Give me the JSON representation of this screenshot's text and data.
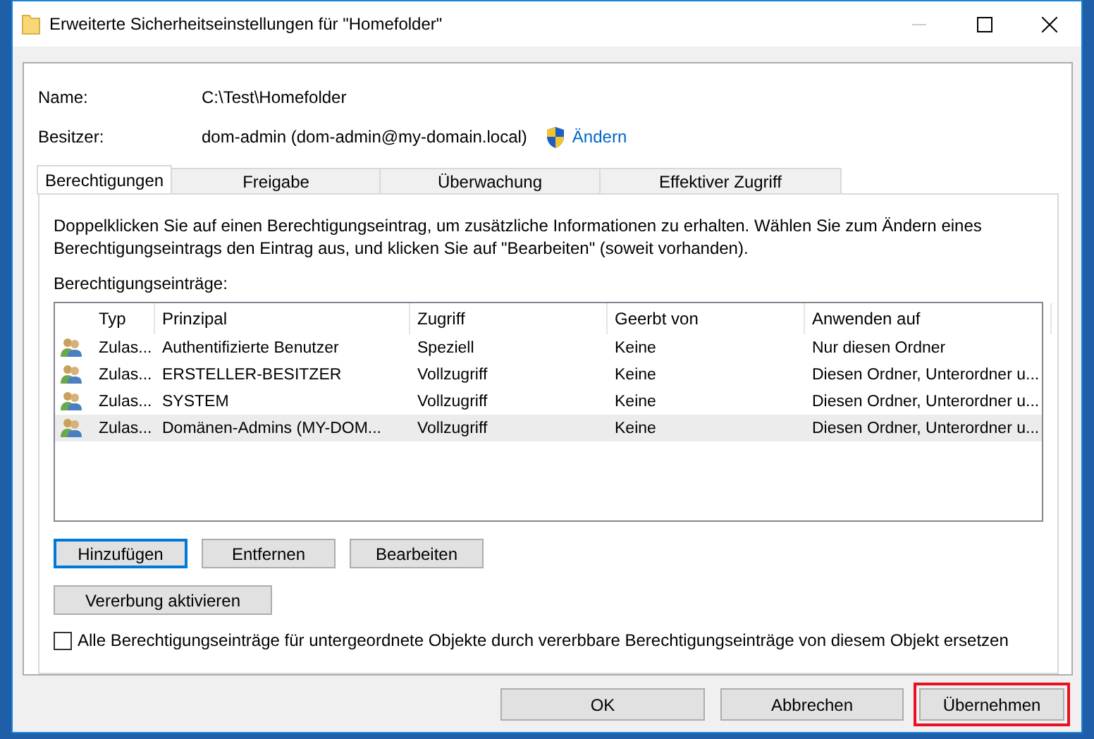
{
  "window": {
    "title": "Erweiterte Sicherheitseinstellungen für \"Homefolder\""
  },
  "info": [
    {
      "label": "Name:",
      "value": "C:\\Test\\Homefolder"
    },
    {
      "label": "Besitzer:",
      "value": "dom-admin (dom-admin@my-domain.local)",
      "link": "Ändern"
    }
  ],
  "tabs": [
    {
      "label": "Berechtigungen",
      "selected": true
    },
    {
      "label": "Freigabe",
      "selected": false
    },
    {
      "label": "Überwachung",
      "selected": false
    },
    {
      "label": "Effektiver Zugriff",
      "selected": false
    }
  ],
  "description": "Doppelklicken Sie auf einen Berechtigungseintrag, um zusätzliche Informationen zu erhalten. Wählen Sie zum Ändern eines Berechtigungseintrags den Eintrag aus, und klicken Sie auf \"Bearbeiten\" (soweit vorhanden).",
  "list_label": "Berechtigungseinträge:",
  "table": {
    "columns": [
      "Typ",
      "Prinzipal",
      "Zugriff",
      "Geerbt von",
      "Anwenden auf"
    ],
    "rows": [
      {
        "cells": [
          "Zulas...",
          "Authentifizierte Benutzer",
          "Speziell",
          "Keine",
          "Nur diesen Ordner"
        ],
        "selected": false
      },
      {
        "cells": [
          "Zulas...",
          "ERSTELLER-BESITZER",
          "Vollzugriff",
          "Keine",
          "Diesen Ordner, Unterordner u..."
        ],
        "selected": false
      },
      {
        "cells": [
          "Zulas...",
          "SYSTEM",
          "Vollzugriff",
          "Keine",
          "Diesen Ordner, Unterordner u..."
        ],
        "selected": false
      },
      {
        "cells": [
          "Zulas...",
          "Domänen-Admins (MY-DOM...",
          "Vollzugriff",
          "Keine",
          "Diesen Ordner, Unterordner u..."
        ],
        "selected": true
      }
    ]
  },
  "entry_buttons": [
    {
      "label": "Hinzufügen",
      "focused": true
    },
    {
      "label": "Entfernen",
      "focused": false
    },
    {
      "label": "Bearbeiten",
      "focused": false
    }
  ],
  "inherit_button": "Vererbung aktivieren",
  "replace_checkbox": {
    "label": "Alle Berechtigungseinträge für untergeordnete Objekte durch vererbbare Berechtigungseinträge von diesem Objekt ersetzen",
    "checked": false
  },
  "dialog_buttons": [
    {
      "label": "OK",
      "highlighted": false
    },
    {
      "label": "Abbrechen",
      "highlighted": false
    },
    {
      "label": "Übernehmen",
      "highlighted": true
    }
  ]
}
